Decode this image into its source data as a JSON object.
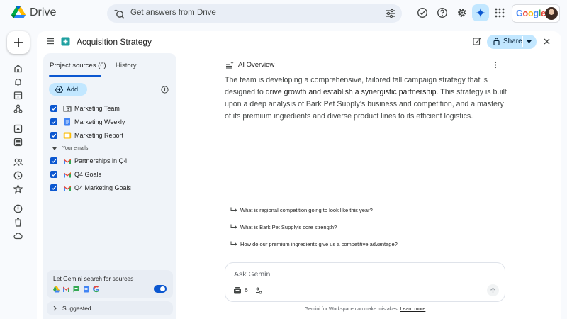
{
  "app": {
    "name": "Drive"
  },
  "search": {
    "placeholder": "Get answers from Drive"
  },
  "google_chip": {
    "label": "Google"
  },
  "doc": {
    "title": "Acquisition Strategy"
  },
  "share": {
    "label": "Share"
  },
  "panel": {
    "tabs": [
      {
        "label": "Project sources (6)",
        "active": true
      },
      {
        "label": "History",
        "active": false
      }
    ],
    "add_label": "Add",
    "sources": [
      {
        "label": "Marketing Team",
        "icon": "folder-icon",
        "checked": true
      },
      {
        "label": "Marketing Weekly",
        "icon": "docs-icon",
        "checked": true
      },
      {
        "label": "Marketing Report",
        "icon": "slides-icon",
        "checked": true
      }
    ],
    "group_label": "Your emails",
    "emails": [
      {
        "label": "Partnerships in Q4",
        "icon": "gmail-icon",
        "checked": true
      },
      {
        "label": "Q4 Goals",
        "icon": "gmail-icon",
        "checked": true
      },
      {
        "label": "Q4 Marketing Goals",
        "icon": "gmail-icon",
        "checked": true
      }
    ],
    "gemini_search_label": "Let Gemini search for sources",
    "gemini_search_enabled": true,
    "suggested_label": "Suggested"
  },
  "overview": {
    "label": "AI Overview",
    "para_1": "The team is developing a comprehensive, tailored fall campaign strategy that is designed to ",
    "para_bold": "drive growth and establish a synergistic partnership.",
    "para_2": " This strategy is built upon a deep analysis of Bark Pet Supply’s business and competition, and a mastery of its premium ingredients and diverse product lines to its efficient logistics."
  },
  "suggestions": [
    "What is regional competition going to look like this year?",
    "What is Bark Pet Supply’s core strength?",
    "How do our premium ingredients give us a competitive advantage?"
  ],
  "ask": {
    "placeholder": "Ask Gemini",
    "source_count": "6"
  },
  "disclaimer": {
    "text": "Gemini for Workspace can make mistakes. ",
    "link": "Learn more"
  },
  "colors": {
    "accent": "#0b57d0",
    "chip_blue": "#c2e7ff",
    "panel_bg": "#f0f4f9",
    "page_bg": "#f8fafd"
  }
}
